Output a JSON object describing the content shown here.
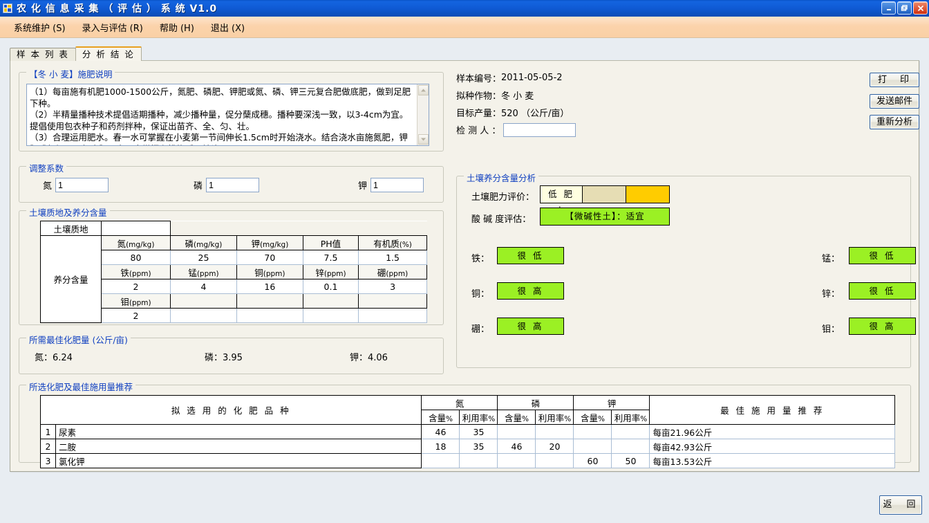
{
  "window": {
    "title": "农 化 信 息 采 集 （ 评 估 ） 系 统    V1.0",
    "icon": "app-icon",
    "buttons": {
      "minimize": "minimize-icon",
      "maximize": "restore-icon",
      "close": "close-icon"
    }
  },
  "menu": [
    {
      "label": "系统维护 (S)"
    },
    {
      "label": "录入与评估 (R)"
    },
    {
      "label": "帮助 (H)"
    },
    {
      "label": "退出 (X)"
    }
  ],
  "tabs": [
    {
      "label": "样 本 列 表",
      "active": false
    },
    {
      "label": "分 析 结 论",
      "active": true
    }
  ],
  "fertilizer_note": {
    "title_crop": "【冬 小 麦】",
    "title_rest": "施肥说明",
    "text": "（1）每亩施有机肥1000-1500公斤，氮肥、磷肥、钾肥或氮、磷、钾三元复合肥做底肥，做到足肥下种。\n（2）半精量播种技术提倡适期播种，减少播种量，促分蘖成穗。播种要深浅一致，以3-4cm为宜。提倡使用包衣种子和药剂拌种，保证出苗齐、全、匀、壮。\n（3）合理运用肥水。春一水可掌握在小麦第一节间伸长1.5cm时开始浇水。结合浇水亩施氮肥，钾肥或氮钾二元复合肥，春二水掌握在挑旗后开始浇。"
  },
  "sample_info": {
    "sample_no_label": "样本编号：",
    "sample_no_value": "2011-05-05-2",
    "crop_label": "拟种作物：",
    "crop_value": "冬 小 麦",
    "yield_label": "目标产量：",
    "yield_value": "520 （公斤/亩）",
    "inspector_label": "检 测 人 ：",
    "inspector_value": "",
    "inspector_placeholder": ""
  },
  "actions": {
    "print": "打　印",
    "send_mail": "发送邮件",
    "reanalyze": "重新分析",
    "return": "返　回"
  },
  "coefficients": {
    "title": "调整系数",
    "items": [
      {
        "label": "氮",
        "value": "1"
      },
      {
        "label": "磷",
        "value": "1"
      },
      {
        "label": "钾",
        "value": "1"
      }
    ]
  },
  "soil_table": {
    "title": "土壤质地及养分含量",
    "texture_label": "土壤质地",
    "texture_value": "",
    "nutrient_label": "养分含量",
    "row1_headers": [
      "氮",
      "磷",
      "钾",
      "PH值",
      "有机质"
    ],
    "row1_units": [
      "(mg/kg)",
      "(mg/kg)",
      "(mg/kg)",
      "",
      "(%)"
    ],
    "row1_values": [
      "80",
      "25",
      "70",
      "7.5",
      "1.5"
    ],
    "row2_headers": [
      "铁",
      "锰",
      "铜",
      "锌",
      "硼"
    ],
    "row2_units": [
      "(ppm)",
      "(ppm)",
      "(ppm)",
      "(ppm)",
      "(ppm)"
    ],
    "row2_values": [
      "2",
      "4",
      "16",
      "0.1",
      "3"
    ],
    "row3_headers": [
      "钼",
      "",
      "",
      "",
      ""
    ],
    "row3_units": [
      "(ppm)",
      "",
      "",
      "",
      ""
    ],
    "row3_values": [
      "2",
      "",
      "",
      "",
      ""
    ]
  },
  "optimal_amount": {
    "title": "所需最佳化肥量 (公斤/亩)",
    "items": [
      {
        "label": "氮：6.24"
      },
      {
        "label": "磷：3.95"
      },
      {
        "label": "钾：4.06"
      }
    ]
  },
  "soil_analysis": {
    "title": "土壤养分含量分析",
    "fertility_label": "土壤肥力评价：",
    "fertility_value": "低 肥 力",
    "fertility_colors": [
      "#FFFFE0",
      "#E6DDB4",
      "#FFCC00"
    ],
    "ph_label": "酸 碱 度评估：",
    "ph_value": "【微碱性土】：适宜",
    "ph_color": "#9BF024",
    "micronutrients": [
      {
        "label": "铁：",
        "value": "很 低",
        "color": "#9BF024"
      },
      {
        "label": "锰：",
        "value": "很 低",
        "color": "#9BF024"
      },
      {
        "label": "铜：",
        "value": "很 高",
        "color": "#9BF024"
      },
      {
        "label": "锌：",
        "value": "很 低",
        "color": "#9BF024"
      },
      {
        "label": "硼：",
        "value": "很 高",
        "color": "#9BF024"
      },
      {
        "label": "钼：",
        "value": "很 高",
        "color": "#9BF024"
      }
    ]
  },
  "recommendation": {
    "title": "所选化肥及最佳施用量推荐",
    "col_variety": "拟 选 用 的 化 肥 品 种",
    "col_n": "氮",
    "col_p": "磷",
    "col_k": "钾",
    "col_content": "含量",
    "col_content_pct": "%",
    "col_rate": "利用率",
    "col_rate_pct": "%",
    "col_best": "最 佳 施 用 量 推 荐",
    "rows": [
      {
        "no": "1",
        "name": "尿素",
        "n_content": "46",
        "n_rate": "35",
        "p_content": "",
        "p_rate": "",
        "k_content": "",
        "k_rate": "",
        "best": "每亩21.96公斤"
      },
      {
        "no": "2",
        "name": "二胺",
        "n_content": "18",
        "n_rate": "35",
        "p_content": "46",
        "p_rate": "20",
        "k_content": "",
        "k_rate": "",
        "best": "每亩42.93公斤"
      },
      {
        "no": "3",
        "name": "氯化钾",
        "n_content": "",
        "n_rate": "",
        "p_content": "",
        "p_rate": "",
        "k_content": "60",
        "k_rate": "50",
        "best": "每亩13.53公斤"
      }
    ]
  }
}
